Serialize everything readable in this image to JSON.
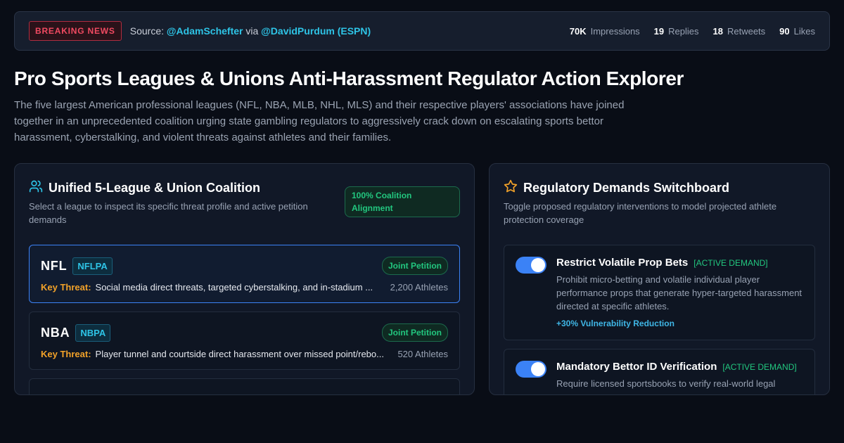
{
  "topbar": {
    "badge": "BREAKING NEWS",
    "source_prefix": "Source: ",
    "source_handle_1": "@AdamSchefter",
    "source_via": " via ",
    "source_handle_2": "@DavidPurdum (ESPN)",
    "stats": [
      {
        "value": "70K",
        "label": "Impressions"
      },
      {
        "value": "19",
        "label": "Replies"
      },
      {
        "value": "18",
        "label": "Retweets"
      },
      {
        "value": "90",
        "label": "Likes"
      }
    ]
  },
  "page": {
    "title": "Pro Sports Leagues & Unions Anti-Harassment Regulator Action Explorer",
    "description": "The five largest American professional leagues (NFL, NBA, MLB, NHL, MLS) and their respective players' associations have joined together in an unprecedented coalition urging state gambling regulators to aggressively crack down on escalating sports bettor harassment, cyberstalking, and violent threats against athletes and their families."
  },
  "coalition_panel": {
    "icon": "users-icon",
    "title": "Unified 5-League & Union Coalition",
    "subtitle": "Select a league to inspect its specific threat profile and active petition demands",
    "alignment_badge": "100% Coalition Alignment",
    "leagues": [
      {
        "name": "NFL",
        "union": "NFLPA",
        "status": "Joint Petition",
        "threat_label": "Key Threat:",
        "threat": "Social media direct threats, targeted cyberstalking, and in-stadium ...",
        "athletes": "2,200 Athletes",
        "selected": true
      },
      {
        "name": "NBA",
        "union": "NBPA",
        "status": "Joint Petition",
        "threat_label": "Key Threat:",
        "threat": "Player tunnel and courtside direct harassment over missed point/rebo...",
        "athletes": "520 Athletes",
        "selected": false
      }
    ]
  },
  "demands_panel": {
    "icon": "star-icon",
    "title": "Regulatory Demands Switchboard",
    "subtitle": "Toggle proposed regulatory interventions to model projected athlete protection coverage",
    "demands": [
      {
        "title": "Restrict Volatile Prop Bets",
        "status": "[ACTIVE DEMAND]",
        "description": "Prohibit micro-betting and volatile individual player performance props that generate hyper-targeted harassment directed at specific athletes.",
        "impact": "+30% Vulnerability Reduction",
        "enabled": true
      },
      {
        "title": "Mandatory Bettor ID Verification",
        "status": "[ACTIVE DEMAND]",
        "description": "Require licensed sportsbooks to verify real-world legal",
        "enabled": true
      }
    ]
  },
  "colors": {
    "background": "#090d16",
    "accent_blue": "#3b82f6",
    "accent_cyan": "#2ec4e6",
    "accent_green": "#22c77f",
    "accent_orange": "#f2a229",
    "breaking_red": "#f04a61"
  }
}
